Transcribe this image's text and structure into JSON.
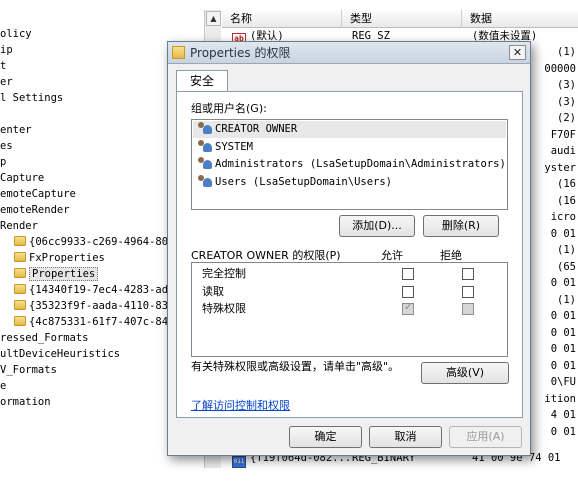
{
  "registry": {
    "tree_items": [
      {
        "label": "olicy",
        "folder": false
      },
      {
        "label": "ip",
        "folder": false
      },
      {
        "label": "t",
        "folder": false
      },
      {
        "label": "er",
        "folder": false
      },
      {
        "label": "l Settings",
        "folder": false
      },
      {
        "label": "",
        "folder": false
      },
      {
        "label": "enter",
        "folder": false
      },
      {
        "label": "es",
        "folder": false
      },
      {
        "label": "p",
        "folder": false
      },
      {
        "label": "Capture",
        "folder": false
      },
      {
        "label": "emoteCapture",
        "folder": false
      },
      {
        "label": "emoteRender",
        "folder": false
      },
      {
        "label": "Render",
        "folder": false
      },
      {
        "label": "{06cc9933-c269-4964-802d",
        "folder": true
      },
      {
        "label": "FxProperties",
        "folder": true
      },
      {
        "label": "Properties",
        "folder": true,
        "selected": true
      },
      {
        "label": "{14340f19-7ec4-4283-ad1d",
        "folder": true
      },
      {
        "label": "{35323f9f-aada-4110-8365",
        "folder": true
      },
      {
        "label": "{4c875331-61f7-407c-8461",
        "folder": true
      },
      {
        "label": "ressed_Formats",
        "folder": false
      },
      {
        "label": "ultDeviceHeuristics",
        "folder": false
      },
      {
        "label": "V_Formats",
        "folder": false
      },
      {
        "label": "e",
        "folder": false
      },
      {
        "label": "ormation",
        "folder": false
      },
      {
        "label": "",
        "folder": false
      }
    ],
    "columns": {
      "name": "名称",
      "type": "类型",
      "data": "数据"
    },
    "default_row": {
      "name": "(默认)",
      "type": "REG_SZ",
      "data": "(数值未设置)"
    },
    "bottom_row": {
      "name": "{f19f064d-082...",
      "type": "REG_BINARY",
      "data": "41 00 9e 74 01"
    },
    "data_fragments": [
      "(1)",
      "00000",
      "(3)",
      "(3)",
      "(2)",
      "F70F",
      "audi",
      "yster",
      "(16",
      "(16",
      "icro",
      "0 01",
      "(1)",
      "(65",
      "0 01",
      "(1)",
      "0 01",
      "0 01",
      "0 01",
      "0 01",
      "0\\FU",
      "ition",
      "4 01",
      "0 01"
    ]
  },
  "dialog": {
    "title": "Properties 的权限",
    "close_glyph": "✕",
    "tab": "安全",
    "group_label": "组或用户名(G):",
    "users": [
      {
        "name": "CREATOR OWNER",
        "selected": true
      },
      {
        "name": "SYSTEM",
        "selected": false
      },
      {
        "name": "Administrators (LsaSetupDomain\\Administrators)",
        "selected": false
      },
      {
        "name": "Users (LsaSetupDomain\\Users)",
        "selected": false
      }
    ],
    "add_button": "添加(D)...",
    "remove_button": "删除(R)",
    "perm_label": "CREATOR OWNER 的权限(P)",
    "allow_header": "允许",
    "deny_header": "拒绝",
    "permissions": [
      {
        "name": "完全控制",
        "allow": false,
        "allow_disabled": false,
        "deny": false,
        "deny_disabled": false
      },
      {
        "name": "读取",
        "allow": false,
        "allow_disabled": false,
        "deny": false,
        "deny_disabled": false
      },
      {
        "name": "特殊权限",
        "allow": true,
        "allow_disabled": true,
        "deny": false,
        "deny_disabled": true
      }
    ],
    "advanced_text": "有关特殊权限或高级设置，请单击\"高级\"。",
    "advanced_button": "高级(V)",
    "help_link": "了解访问控制和权限",
    "ok_button": "确定",
    "cancel_button": "取消",
    "apply_button": "应用(A)"
  },
  "colors": {
    "link": "#0044cc",
    "dialog_bg": "#f0f0f0",
    "selection": "#e8e8e8"
  }
}
